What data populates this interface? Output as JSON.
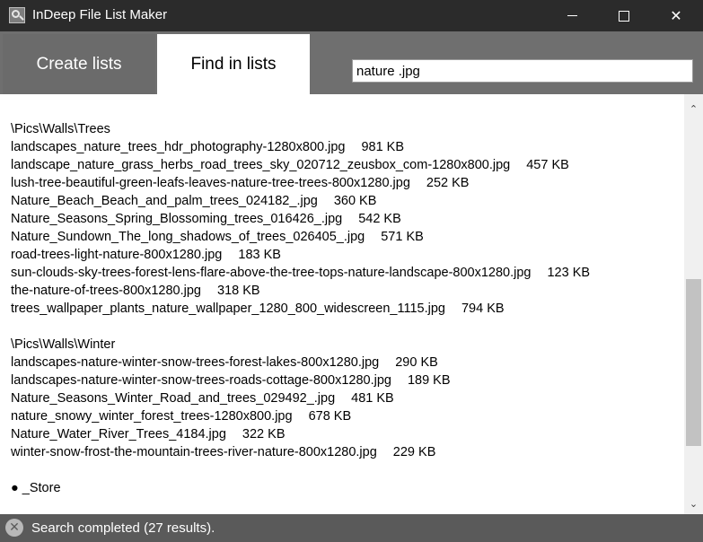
{
  "window": {
    "title": "InDeep File List Maker",
    "minimize_glyph": "",
    "close_glyph": "✕"
  },
  "tabs": [
    {
      "label": "Create lists",
      "active": false
    },
    {
      "label": "Find in lists",
      "active": true
    }
  ],
  "search": {
    "value": "nature .jpg"
  },
  "results": {
    "groups": [
      {
        "path": "\\Pics\\Walls\\Trees",
        "files": [
          {
            "name": "landscapes_nature_trees_hdr_photography-1280x800.jpg",
            "size": "981 KB"
          },
          {
            "name": "landscape_nature_grass_herbs_road_trees_sky_020712_zeusbox_com-1280x800.jpg",
            "size": "457 KB"
          },
          {
            "name": "lush-tree-beautiful-green-leafs-leaves-nature-tree-trees-800x1280.jpg",
            "size": "252 KB"
          },
          {
            "name": "Nature_Beach_Beach_and_palm_trees_024182_.jpg",
            "size": "360 KB"
          },
          {
            "name": "Nature_Seasons_Spring_Blossoming_trees_016426_.jpg",
            "size": "542 KB"
          },
          {
            "name": "Nature_Sundown_The_long_shadows_of_trees_026405_.jpg",
            "size": "571 KB"
          },
          {
            "name": "road-trees-light-nature-800x1280.jpg",
            "size": "183 KB"
          },
          {
            "name": "sun-clouds-sky-trees-forest-lens-flare-above-the-tree-tops-nature-landscape-800x1280.jpg",
            "size": "123 KB"
          },
          {
            "name": "the-nature-of-trees-800x1280.jpg",
            "size": "318 KB"
          },
          {
            "name": "trees_wallpaper_plants_nature_wallpaper_1280_800_widescreen_1115.jpg",
            "size": "794 KB"
          }
        ]
      },
      {
        "path": "\\Pics\\Walls\\Winter",
        "files": [
          {
            "name": "landscapes-nature-winter-snow-trees-forest-lakes-800x1280.jpg",
            "size": "290 KB"
          },
          {
            "name": "landscapes-nature-winter-snow-trees-roads-cottage-800x1280.jpg",
            "size": "189 KB"
          },
          {
            "name": "Nature_Seasons_Winter_Road_and_trees_029492_.jpg",
            "size": "481 KB"
          },
          {
            "name": "nature_snowy_winter_forest_trees-1280x800.jpg",
            "size": "678 KB"
          },
          {
            "name": "Nature_Water_River_Trees_4184.jpg",
            "size": "322 KB"
          },
          {
            "name": "winter-snow-frost-the-mountain-trees-river-nature-800x1280.jpg",
            "size": "229 KB"
          }
        ]
      }
    ],
    "list_header": "● _Store"
  },
  "scrollbar": {
    "up_glyph": "⌃",
    "down_glyph": "⌄"
  },
  "status": {
    "text": "Search completed (27 results).",
    "icon": "close-circle-icon",
    "icon_glyph": "✕"
  },
  "colors": {
    "titlebar": "#2b2b2b",
    "tabbar": "#6f6f6f",
    "statusbar": "#5a5a5a"
  }
}
